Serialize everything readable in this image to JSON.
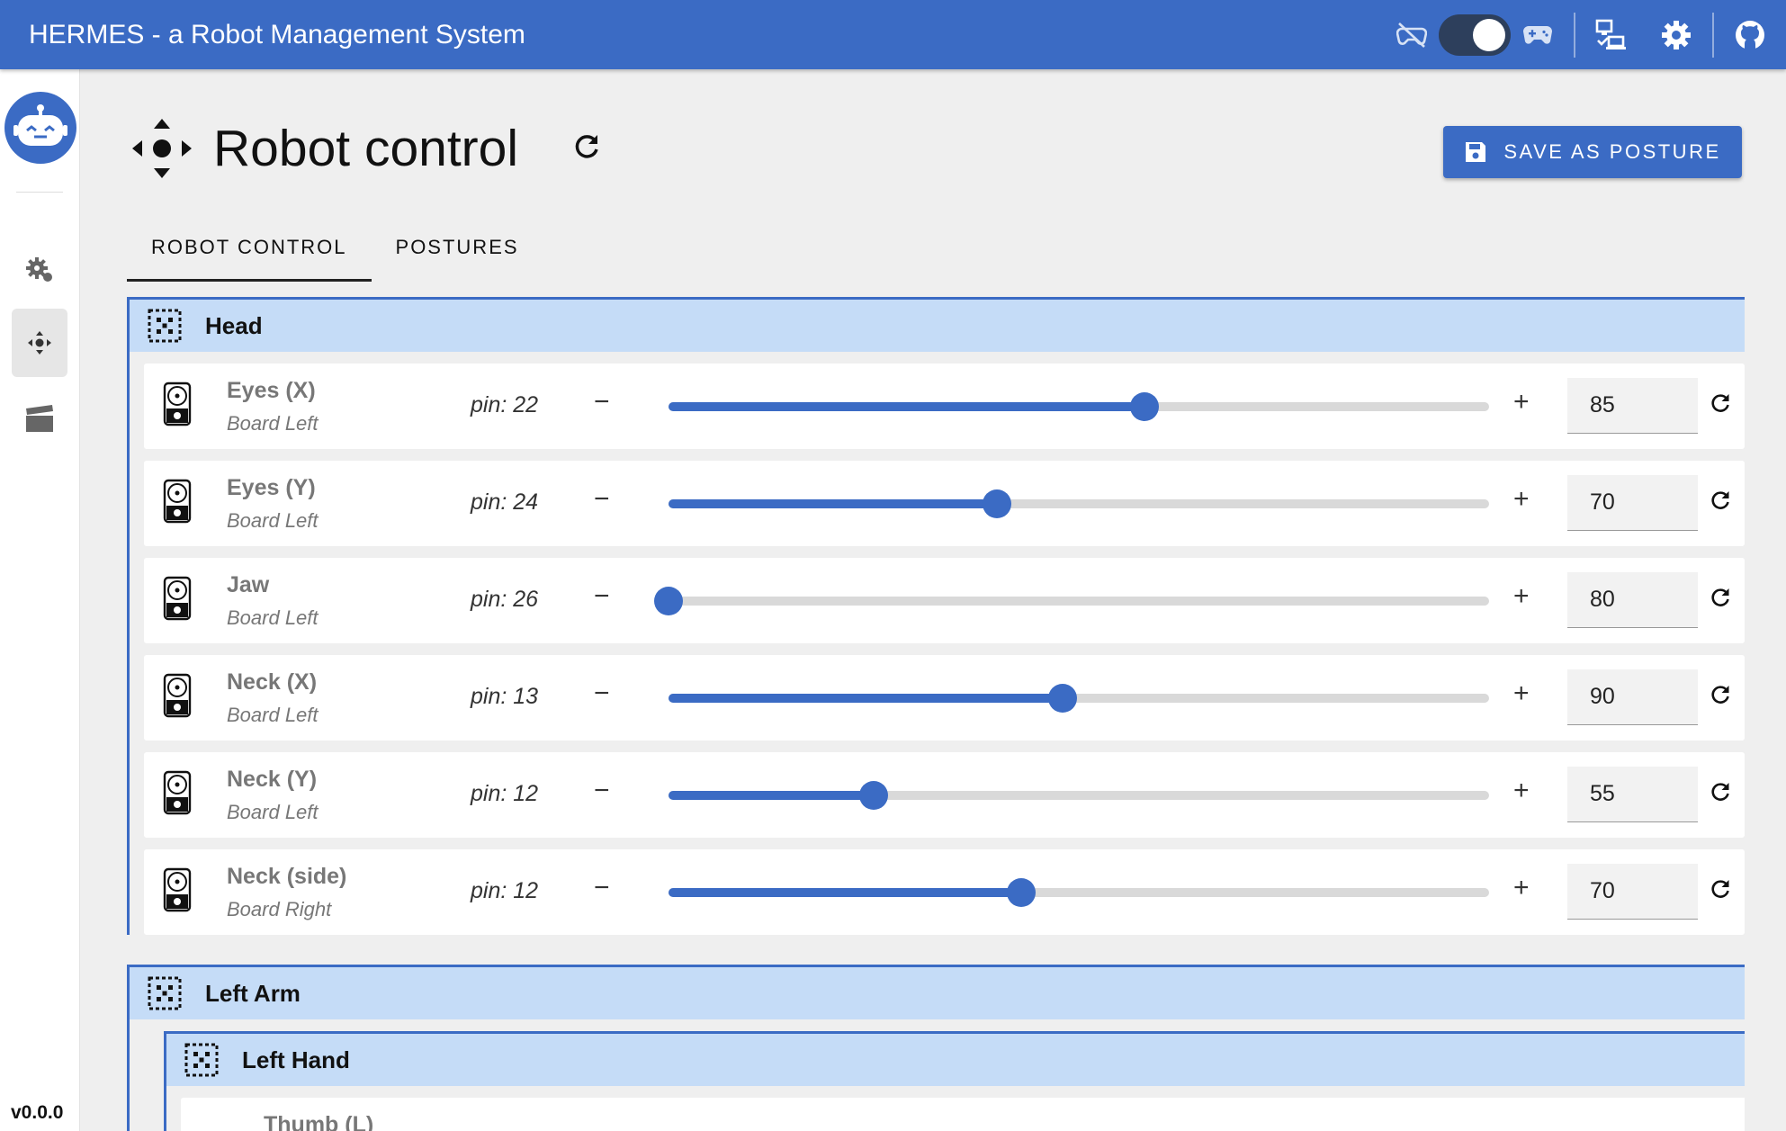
{
  "app": {
    "title": "HERMES - a Robot Management System",
    "version": "v0.0.0"
  },
  "toolbar": {
    "icons": [
      "gamepad-off-icon",
      "toggle-switch",
      "gamepad-icon",
      "remote-desktop-icon",
      "gear-icon",
      "github-icon"
    ]
  },
  "sidebar": {
    "items": [
      "gears-icon",
      "move-arrows-icon",
      "clapperboard-icon"
    ],
    "active": 1
  },
  "page": {
    "title": "Robot control",
    "save_button": "SAVE AS POSTURE",
    "tabs": [
      {
        "label": "ROBOT CONTROL",
        "active": true
      },
      {
        "label": "POSTURES",
        "active": false
      }
    ]
  },
  "groups": [
    {
      "name": "Head",
      "servos": [
        {
          "name": "Eyes (X)",
          "board": "Board Left",
          "pin": "pin: 22",
          "value": "85",
          "level": 0.58
        },
        {
          "name": "Eyes (Y)",
          "board": "Board Left",
          "pin": "pin: 24",
          "value": "70",
          "level": 0.4
        },
        {
          "name": "Jaw",
          "board": "Board Left",
          "pin": "pin: 26",
          "value": "80",
          "level": 0.0
        },
        {
          "name": "Neck (X)",
          "board": "Board Left",
          "pin": "pin: 13",
          "value": "90",
          "level": 0.48
        },
        {
          "name": "Neck (Y)",
          "board": "Board Left",
          "pin": "pin: 12",
          "value": "55",
          "level": 0.25
        },
        {
          "name": "Neck (side)",
          "board": "Board Right",
          "pin": "pin: 12",
          "value": "70",
          "level": 0.43
        }
      ]
    },
    {
      "name": "Left Arm"
    },
    {
      "name": "Left Hand",
      "partial_row": "Thumb (L)"
    }
  ],
  "colors": {
    "accent": "#3b6bc4",
    "group_header": "#c5dcf7"
  }
}
